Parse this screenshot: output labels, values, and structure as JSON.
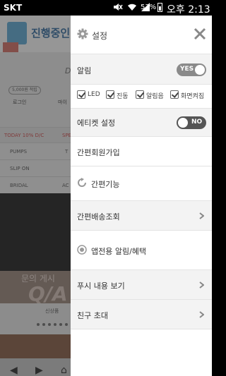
{
  "status_bar": {
    "carrier": "SKT",
    "battery": "53%",
    "time": "오후 2:13"
  },
  "background_app": {
    "logo_text": "진행중인",
    "stamp_text": "",
    "points_pill": "5,000원 적립",
    "login_label": "로그인",
    "mypage_label": "마이",
    "strip_left": "TODAY 10% D/C",
    "strip_right": "SPE",
    "rows": [
      {
        "left": "PUMPS",
        "right": "T"
      },
      {
        "left": "SLIP ON",
        "right": ""
      },
      {
        "left": "BRIDAL",
        "right": "AC"
      }
    ],
    "qa_sub": "문의 게시",
    "qa_main": "Q/A",
    "new_label": "신상품",
    "nav": [
      "◀",
      "▶"
    ]
  },
  "drawer": {
    "title": "설정",
    "alarm": {
      "label": "알림",
      "toggle_text": "YES",
      "options": [
        {
          "label": "LED"
        },
        {
          "label": "진동"
        },
        {
          "label": "알림음"
        },
        {
          "label": "화면켜짐"
        }
      ]
    },
    "etiquette": {
      "label": "에티켓 설정",
      "toggle_text": "NO"
    },
    "simple_signup": "간편회원가입",
    "simple_function": "간편기능",
    "simple_delivery": "간편배송조회",
    "app_alarm": "앱전용 알림/혜택",
    "push_view": "푸시 내용 보기",
    "invite_friend": "친구 초대"
  },
  "colors": {
    "toggle_on": "#8a8a8a",
    "toggle_off": "#555555",
    "grey_row": "#f3f3f3"
  }
}
